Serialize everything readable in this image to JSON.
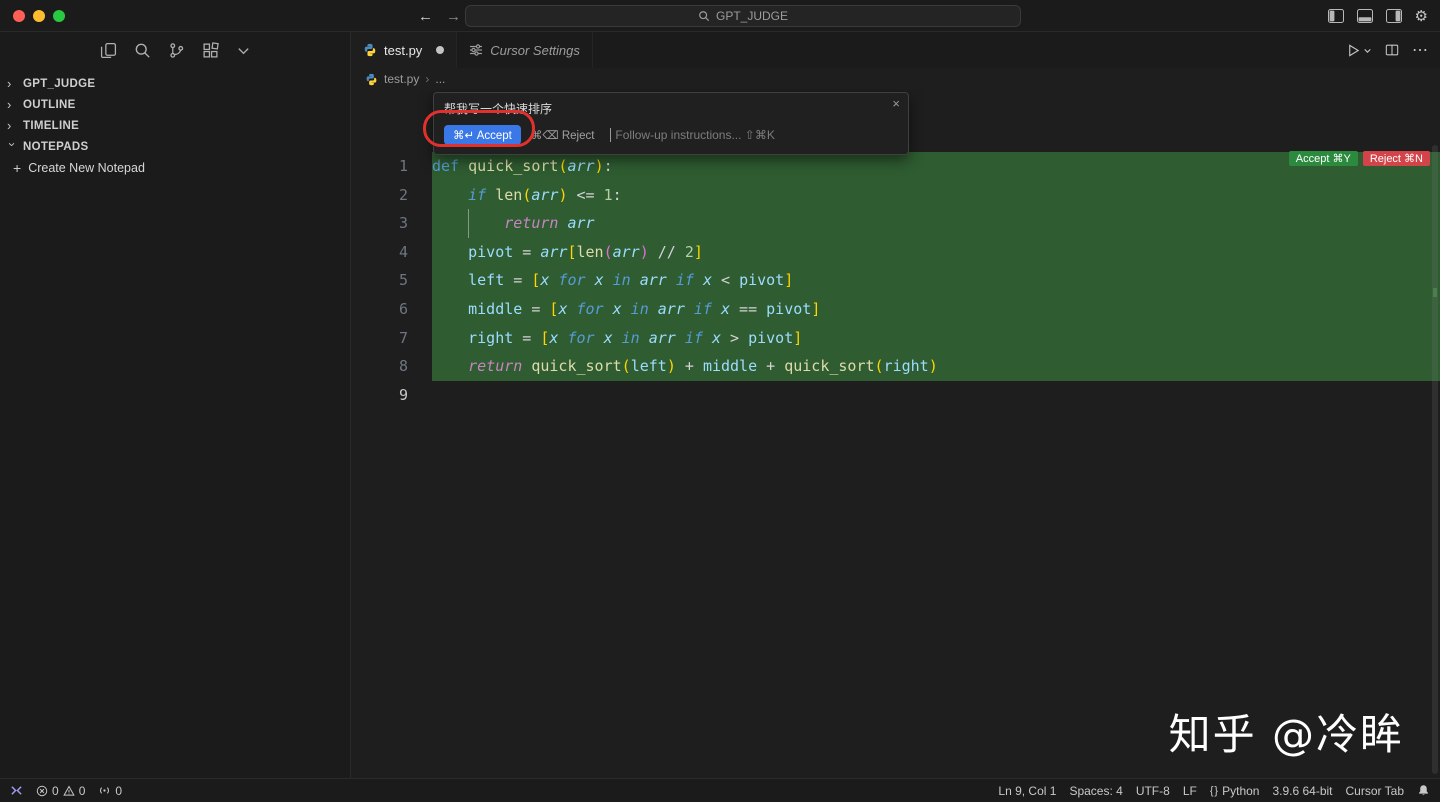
{
  "titlebar": {
    "search_label": "GPT_JUDGE"
  },
  "sidebar": {
    "tree": [
      {
        "label": "GPT_JUDGE",
        "expanded": false
      },
      {
        "label": "OUTLINE",
        "expanded": false
      },
      {
        "label": "TIMELINE",
        "expanded": false
      },
      {
        "label": "NOTEPADS",
        "expanded": true
      }
    ],
    "create_notepad": "Create New Notepad"
  },
  "tabs": [
    {
      "label": "test.py"
    },
    {
      "label": "Cursor Settings"
    }
  ],
  "breadcrumb": {
    "file": "test.py",
    "more": "..."
  },
  "inline_chat": {
    "prompt": "帮我写一个快速排序",
    "accept_label": "⌘↵ Accept",
    "reject_label": "⌘⌫ Reject",
    "followup_placeholder": "Follow-up instructions... ⇧⌘K",
    "close": "×"
  },
  "diff_actions": {
    "accept": "Accept ⌘Y",
    "reject": "Reject ⌘N"
  },
  "editor": {
    "lines": [
      {
        "num": "1",
        "highlight": true,
        "tokens": [
          [
            "def ",
            "kw"
          ],
          [
            "quick_sort",
            "fn"
          ],
          [
            "(",
            "br1"
          ],
          [
            "arr",
            "param"
          ],
          [
            ")",
            "br1"
          ],
          [
            ":",
            "pl"
          ]
        ]
      },
      {
        "num": "2",
        "highlight": true,
        "tokens": [
          [
            "    ",
            null
          ],
          [
            "if ",
            "ctrl"
          ],
          [
            "len",
            "fn"
          ],
          [
            "(",
            "br1"
          ],
          [
            "arr",
            "param"
          ],
          [
            ")",
            "br1"
          ],
          [
            " <= ",
            "op"
          ],
          [
            "1",
            "num"
          ],
          [
            ":",
            "pl"
          ]
        ]
      },
      {
        "num": "3",
        "highlight": true,
        "guide": true,
        "tokens": [
          [
            "        ",
            null
          ],
          [
            "return ",
            "ret"
          ],
          [
            "arr",
            "param"
          ]
        ]
      },
      {
        "num": "4",
        "highlight": true,
        "tokens": [
          [
            "    ",
            null
          ],
          [
            "pivot",
            "var"
          ],
          [
            " = ",
            "op"
          ],
          [
            "arr",
            "param"
          ],
          [
            "[",
            "br1"
          ],
          [
            "len",
            "fn"
          ],
          [
            "(",
            "br2"
          ],
          [
            "arr",
            "param"
          ],
          [
            ")",
            "br2"
          ],
          [
            " // ",
            "op"
          ],
          [
            "2",
            "num"
          ],
          [
            "]",
            "br1"
          ]
        ]
      },
      {
        "num": "5",
        "highlight": true,
        "tokens": [
          [
            "    ",
            null
          ],
          [
            "left",
            "var"
          ],
          [
            " = ",
            "op"
          ],
          [
            "[",
            "br1"
          ],
          [
            "x",
            "param"
          ],
          [
            " for ",
            "ctrl"
          ],
          [
            "x",
            "param"
          ],
          [
            " in ",
            "ctrl"
          ],
          [
            "arr",
            "param"
          ],
          [
            " if ",
            "ctrl"
          ],
          [
            "x",
            "param"
          ],
          [
            " < ",
            "op"
          ],
          [
            "pivot",
            "var"
          ],
          [
            "]",
            "br1"
          ]
        ]
      },
      {
        "num": "6",
        "highlight": true,
        "tokens": [
          [
            "    ",
            null
          ],
          [
            "middle",
            "var"
          ],
          [
            " = ",
            "op"
          ],
          [
            "[",
            "br1"
          ],
          [
            "x",
            "param"
          ],
          [
            " for ",
            "ctrl"
          ],
          [
            "x",
            "param"
          ],
          [
            " in ",
            "ctrl"
          ],
          [
            "arr",
            "param"
          ],
          [
            " if ",
            "ctrl"
          ],
          [
            "x",
            "param"
          ],
          [
            " == ",
            "op"
          ],
          [
            "pivot",
            "var"
          ],
          [
            "]",
            "br1"
          ]
        ]
      },
      {
        "num": "7",
        "highlight": true,
        "tokens": [
          [
            "    ",
            null
          ],
          [
            "right",
            "var"
          ],
          [
            " = ",
            "op"
          ],
          [
            "[",
            "br1"
          ],
          [
            "x",
            "param"
          ],
          [
            " for ",
            "ctrl"
          ],
          [
            "x",
            "param"
          ],
          [
            " in ",
            "ctrl"
          ],
          [
            "arr",
            "param"
          ],
          [
            " if ",
            "ctrl"
          ],
          [
            "x",
            "param"
          ],
          [
            " > ",
            "op"
          ],
          [
            "pivot",
            "var"
          ],
          [
            "]",
            "br1"
          ]
        ]
      },
      {
        "num": "8",
        "highlight": true,
        "tokens": [
          [
            "    ",
            null
          ],
          [
            "return ",
            "ret"
          ],
          [
            "quick_sort",
            "fn"
          ],
          [
            "(",
            "br1"
          ],
          [
            "left",
            "var"
          ],
          [
            ")",
            "br1"
          ],
          [
            " + ",
            "op"
          ],
          [
            "middle",
            "var"
          ],
          [
            " + ",
            "op"
          ],
          [
            "quick_sort",
            "fn"
          ],
          [
            "(",
            "br1"
          ],
          [
            "right",
            "var"
          ],
          [
            ")",
            "br1"
          ]
        ]
      },
      {
        "num": "9",
        "highlight": false,
        "current": true,
        "tokens": []
      }
    ]
  },
  "statusbar": {
    "left": {
      "errors": "0",
      "warnings": "0",
      "ports": "0"
    },
    "right": {
      "position": "Ln 9, Col 1",
      "indentation": "Spaces: 4",
      "encoding": "UTF-8",
      "eol": "LF",
      "language": "Python",
      "interpreter": "3.9.6 64-bit",
      "cursor_tab": "Cursor Tab"
    }
  },
  "watermark": "知乎 @冷眸",
  "colors": {
    "accent_blue": "#3b78e7",
    "diff_add_bg": "#2f5c31",
    "badge_accept": "#2b8a3e",
    "badge_reject": "#d2434a",
    "annotation_red": "#e0312e"
  }
}
